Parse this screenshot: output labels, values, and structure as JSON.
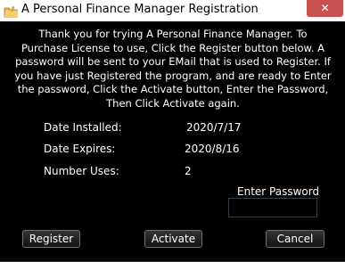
{
  "window": {
    "title": "A Personal Finance Manager Registration",
    "close_label": "✕",
    "icon": "folder-app-icon"
  },
  "message": "Thank you for trying A Personal Finance Manager. To Purchase License to use, Click the Register button below. A password will be sent to your EMail that is used to Register. If you have just Registered the program, and are ready to Enter the password, Click the Activate button, Enter the Password, Then Click Activate again.",
  "info": {
    "installed_label": "Date Installed:",
    "installed_value": "2020/7/17",
    "expires_label": "Date Expires:",
    "expires_value": "2020/8/16",
    "uses_label": "Number Uses:",
    "uses_value": "2"
  },
  "password": {
    "label": "Enter Password",
    "value": ""
  },
  "buttons": {
    "register": "Register",
    "activate": "Activate",
    "cancel": "Cancel"
  },
  "colors": {
    "background": "#000000",
    "close_button": "#c75050",
    "text": "#ffffff"
  }
}
